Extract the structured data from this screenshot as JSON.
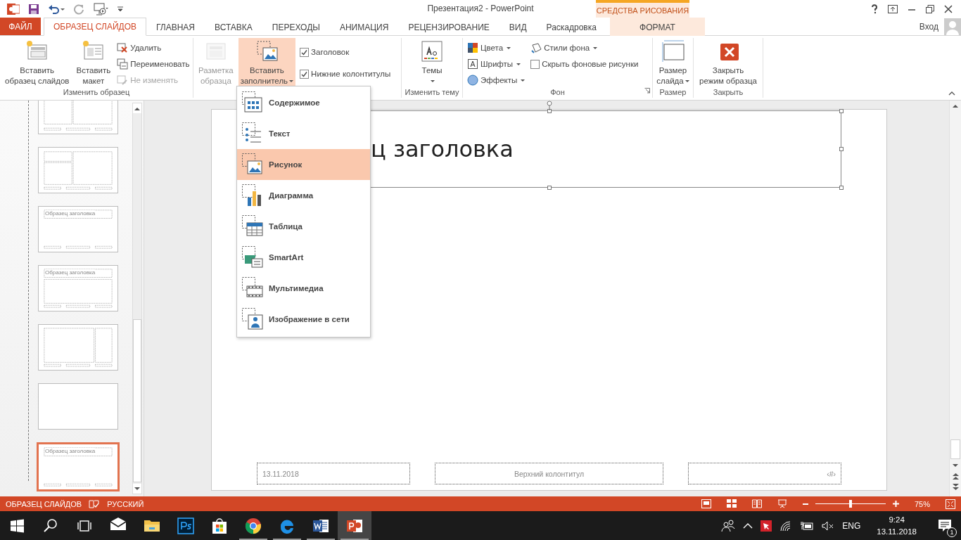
{
  "window": {
    "title": "Презентация2 - PowerPoint",
    "contextual_group": "СРЕДСТВА РИСОВАНИЯ",
    "sign_in": "Вход"
  },
  "tabs": [
    {
      "label": "ФАЙЛ",
      "kind": "file",
      "selected": false
    },
    {
      "label": "ОБРАЗЕЦ СЛАЙДОВ",
      "kind": "normal",
      "selected": true
    },
    {
      "label": "ГЛАВНАЯ",
      "kind": "normal",
      "selected": false
    },
    {
      "label": "ВСТАВКА",
      "kind": "normal",
      "selected": false
    },
    {
      "label": "ПЕРЕХОДЫ",
      "kind": "normal",
      "selected": false
    },
    {
      "label": "АНИМАЦИЯ",
      "kind": "normal",
      "selected": false
    },
    {
      "label": "РЕЦЕНЗИРОВАНИЕ",
      "kind": "normal",
      "selected": false
    },
    {
      "label": "ВИД",
      "kind": "normal",
      "selected": false
    },
    {
      "label": "Раскадровка",
      "kind": "normal",
      "selected": false
    },
    {
      "label": "ФОРМАТ",
      "kind": "contextual",
      "selected": false
    }
  ],
  "ribbon": {
    "groups": [
      {
        "label": "Изменить образец",
        "columns": [
          [
            {
              "kind": "large",
              "lines": [
                "Вставить",
                "образец слайдов"
              ],
              "disabled": false,
              "dropdown": false,
              "expanded": false
            }
          ],
          [
            {
              "kind": "large",
              "lines": [
                "Вставить",
                "макет"
              ],
              "disabled": false,
              "dropdown": false,
              "expanded": false
            }
          ],
          [
            {
              "kind": "small",
              "label": "Удалить",
              "disabled": false,
              "dropdown": false
            },
            {
              "kind": "small",
              "label": "Переименовать",
              "disabled": false,
              "dropdown": false
            },
            {
              "kind": "small",
              "label": "Не изменять",
              "disabled": true,
              "dropdown": false
            }
          ]
        ]
      },
      {
        "columns": [
          [
            {
              "kind": "large",
              "lines": [
                "Разметка",
                "образца"
              ],
              "disabled": true,
              "dropdown": false,
              "expanded": false
            }
          ],
          [
            {
              "kind": "large",
              "lines": [
                "Вставить",
                "заполнитель"
              ],
              "disabled": false,
              "dropdown": true,
              "expanded": true
            }
          ],
          [
            {
              "kind": "check",
              "label": "Заголовок",
              "checked": true
            },
            {
              "kind": "check",
              "label": "Нижние колонтитулы",
              "checked": true
            }
          ]
        ]
      },
      {
        "label": "Изменить тему",
        "columns": [
          [
            {
              "kind": "large",
              "lines": [
                "Темы"
              ],
              "disabled": false,
              "dropdown": true,
              "expanded": false
            }
          ]
        ]
      },
      {
        "label": "Фон",
        "launcher": true,
        "columns": [
          [
            {
              "kind": "small",
              "label": "Цвета",
              "disabled": false,
              "dropdown": true
            },
            {
              "kind": "small",
              "label": "Шрифты",
              "disabled": false,
              "dropdown": true
            },
            {
              "kind": "small",
              "label": "Эффекты",
              "disabled": false,
              "dropdown": true
            }
          ],
          [
            {
              "kind": "small",
              "label": "Стили фона",
              "disabled": false,
              "dropdown": true
            },
            {
              "kind": "check",
              "label": "Скрыть фоновые рисунки",
              "checked": false
            }
          ]
        ]
      },
      {
        "label": "Размер",
        "columns": [
          [
            {
              "kind": "large",
              "lines": [
                "Размер",
                "слайда"
              ],
              "disabled": false,
              "dropdown": true,
              "expanded": false
            }
          ]
        ]
      },
      {
        "label": "Закрыть",
        "columns": [
          [
            {
              "kind": "large",
              "lines": [
                "Закрыть",
                "режим образца"
              ],
              "disabled": false,
              "dropdown": false,
              "expanded": false
            }
          ]
        ]
      }
    ]
  },
  "placeholder_menu": {
    "items": [
      {
        "label": "Содержимое",
        "selected": false
      },
      {
        "label": "Текст",
        "selected": false
      },
      {
        "label": "Рисунок",
        "selected": true
      },
      {
        "label": "Диаграмма",
        "selected": false
      },
      {
        "label": "Таблица",
        "selected": false
      },
      {
        "label": "SmartArt",
        "selected": false
      },
      {
        "label": "Мультимедиа",
        "selected": false
      },
      {
        "label": "Изображение в сети",
        "selected": false
      }
    ]
  },
  "thumbnails": [
    {
      "kind": "two_content",
      "selected": false
    },
    {
      "kind": "picture",
      "selected": false
    },
    {
      "kind": "title_only",
      "title": "Образец заголовка",
      "selected": false
    },
    {
      "kind": "vertical_text",
      "title": "Образец заголовка",
      "selected": false
    },
    {
      "kind": "vertical_title",
      "selected": false
    },
    {
      "kind": "blank",
      "selected": false
    },
    {
      "kind": "title_only",
      "title": "Образец заголовка",
      "selected": true
    }
  ],
  "slide": {
    "title": "ц заголовка",
    "date": "13.11.2018",
    "footer": "Верхний колонтитул",
    "number": "‹#›"
  },
  "status_bar": {
    "mode": "ОБРАЗЕЦ СЛАЙДОВ",
    "language": "РУССКИЙ",
    "zoom": {
      "level": 0.5,
      "reading": "75%"
    }
  },
  "taskbar": {
    "apps": [
      {
        "kind": "mail",
        "running": false,
        "active": false
      },
      {
        "kind": "explorer",
        "running": false,
        "active": false
      },
      {
        "kind": "photoshop",
        "running": false,
        "active": false
      },
      {
        "kind": "store",
        "running": false,
        "active": false
      },
      {
        "kind": "chrome",
        "running": true,
        "active": false
      },
      {
        "kind": "edge",
        "running": true,
        "active": false
      },
      {
        "kind": "word",
        "running": true,
        "active": false
      },
      {
        "kind": "powerpoint",
        "running": true,
        "active": true
      }
    ],
    "language": "ENG",
    "time": "9:24",
    "date": "13.11.2018",
    "notifications": "1"
  }
}
